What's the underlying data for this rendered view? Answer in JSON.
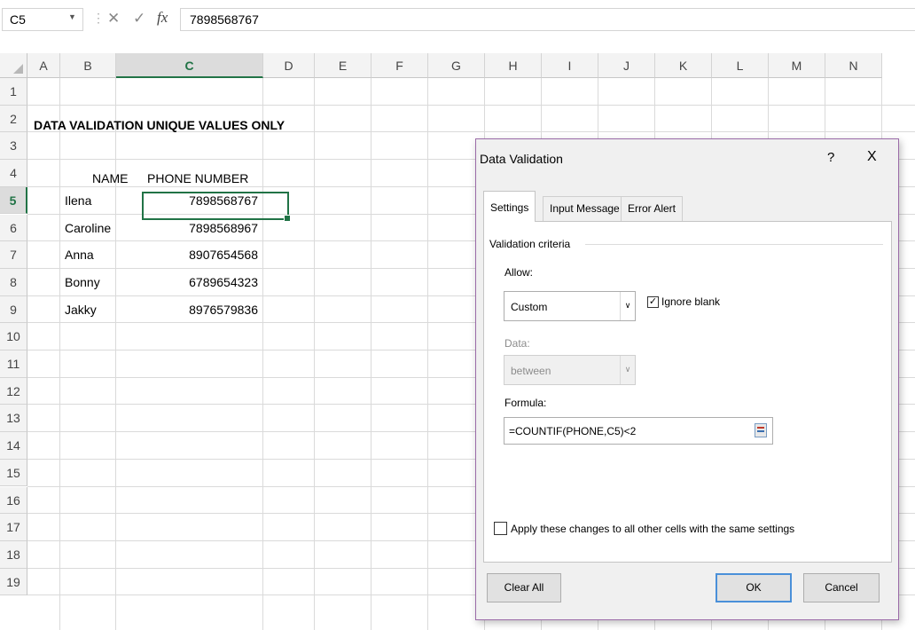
{
  "formula_bar": {
    "name_box": "C5",
    "cancel_glyph": "✕",
    "enter_glyph": "✓",
    "fx_label": "fx",
    "formula": "7898568767"
  },
  "sheet": {
    "columns": [
      "A",
      "B",
      "C",
      "D",
      "E",
      "F",
      "G",
      "H",
      "I",
      "J",
      "K",
      "L",
      "M",
      "N"
    ],
    "rows": [
      "1",
      "2",
      "3",
      "4",
      "5",
      "6",
      "7",
      "8",
      "9",
      "10",
      "11",
      "12",
      "13",
      "14",
      "15",
      "16",
      "17",
      "18",
      "19"
    ],
    "selected_column": "C",
    "selected_row": "5",
    "title": "DATA VALIDATION UNIQUE VALUES ONLY",
    "header_name": "NAME",
    "header_phone": "PHONE NUMBER",
    "names": [
      "Ilena",
      "Caroline",
      "Anna",
      "Bonny",
      "Jakky"
    ],
    "phones": [
      "7898568767",
      "7898568967",
      "8907654568",
      "6789654323",
      "8976579836"
    ]
  },
  "dialog": {
    "title": "Data Validation",
    "help": "?",
    "close": "X",
    "tabs": [
      "Settings",
      "Input Message",
      "Error Alert"
    ],
    "section": "Validation criteria",
    "allow_label": "Allow:",
    "allow_value": "Custom",
    "ignore_blank": "Ignore blank",
    "data_label": "Data:",
    "data_value": "between",
    "formula_label": "Formula:",
    "formula_value": "=COUNTIF(PHONE,C5)<2",
    "apply_label": "Apply these changes to all other cells with the same settings",
    "clear_all": "Clear All",
    "ok": "OK",
    "cancel": "Cancel"
  }
}
